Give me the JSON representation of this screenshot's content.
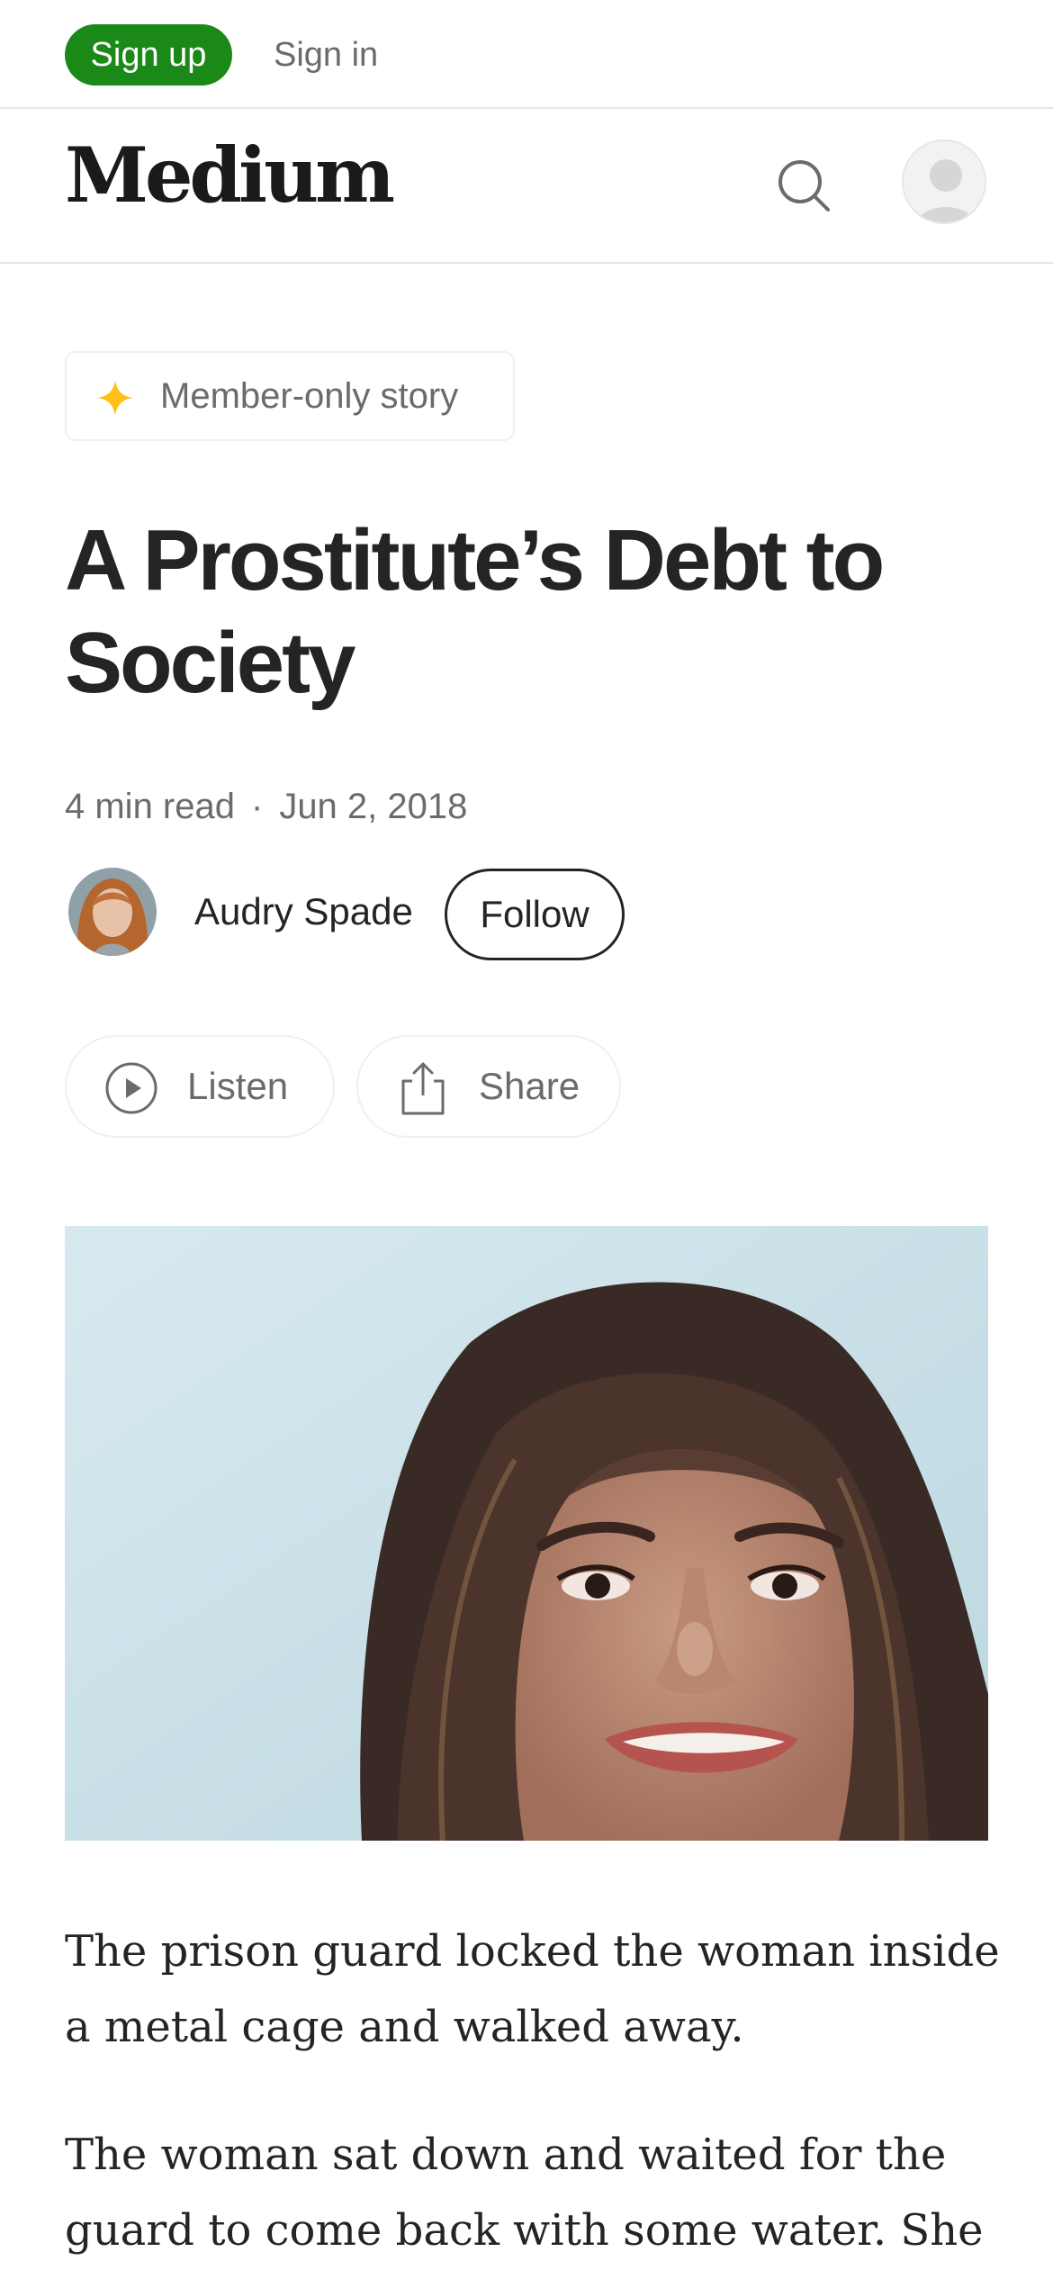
{
  "auth_bar": {
    "signup_label": "Sign up",
    "signin_label": "Sign in",
    "accent_color": "#1a8917"
  },
  "header": {
    "logo_text": "Medium",
    "icons": {
      "search": "search-icon",
      "avatar": "user-avatar-icon"
    }
  },
  "article": {
    "member_badge": {
      "label": "Member-only story",
      "icon": "sparkle-star-icon",
      "icon_color": "#ffc017"
    },
    "title": "A Prostitute’s Debt to Society",
    "read_time": "4 min read",
    "separator": "·",
    "date": "Jun 2, 2018",
    "author": {
      "name": "Audry Spade",
      "follow_label": "Follow"
    },
    "actions": {
      "listen_label": "Listen",
      "listen_icon": "play-circle-icon",
      "share_label": "Share",
      "share_icon": "share-icon"
    },
    "paragraphs": [
      "The prison guard locked the woman inside a metal cage and walked away.",
      "The woman sat down and waited for the guard to come back with some water. She"
    ]
  }
}
